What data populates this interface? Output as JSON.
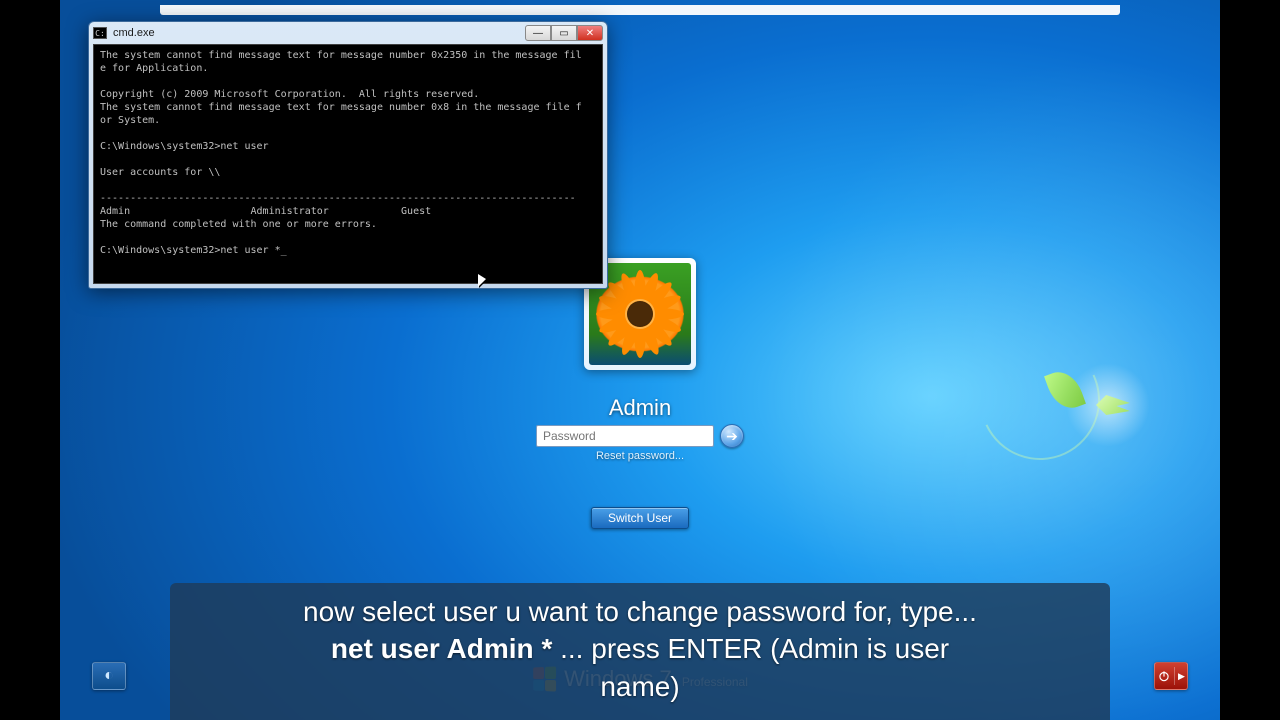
{
  "cmd": {
    "title": "cmd.exe",
    "lines": "The system cannot find message text for message number 0x2350 in the message fil\ne for Application.\n\nCopyright (c) 2009 Microsoft Corporation.  All rights reserved.\nThe system cannot find message text for message number 0x8 in the message file f\nor System.\n\nC:\\Windows\\system32>net user\n\nUser accounts for \\\\\n\n-------------------------------------------------------------------------------\nAdmin                    Administrator            Guest\nThe command completed with one or more errors.\n\nC:\\Windows\\system32>net user *_"
  },
  "login": {
    "username": "Admin",
    "password_placeholder": "Password",
    "reset_link": "Reset password...",
    "switch_user": "Switch User"
  },
  "branding": {
    "product": "Windows",
    "version": "7",
    "edition": "Professional"
  },
  "caption": {
    "line1": "now select user u want to change password for, type...",
    "bold": "net user Admin *",
    "line2a": " ... press ENTER (Admin is user",
    "line2b": "name)"
  }
}
